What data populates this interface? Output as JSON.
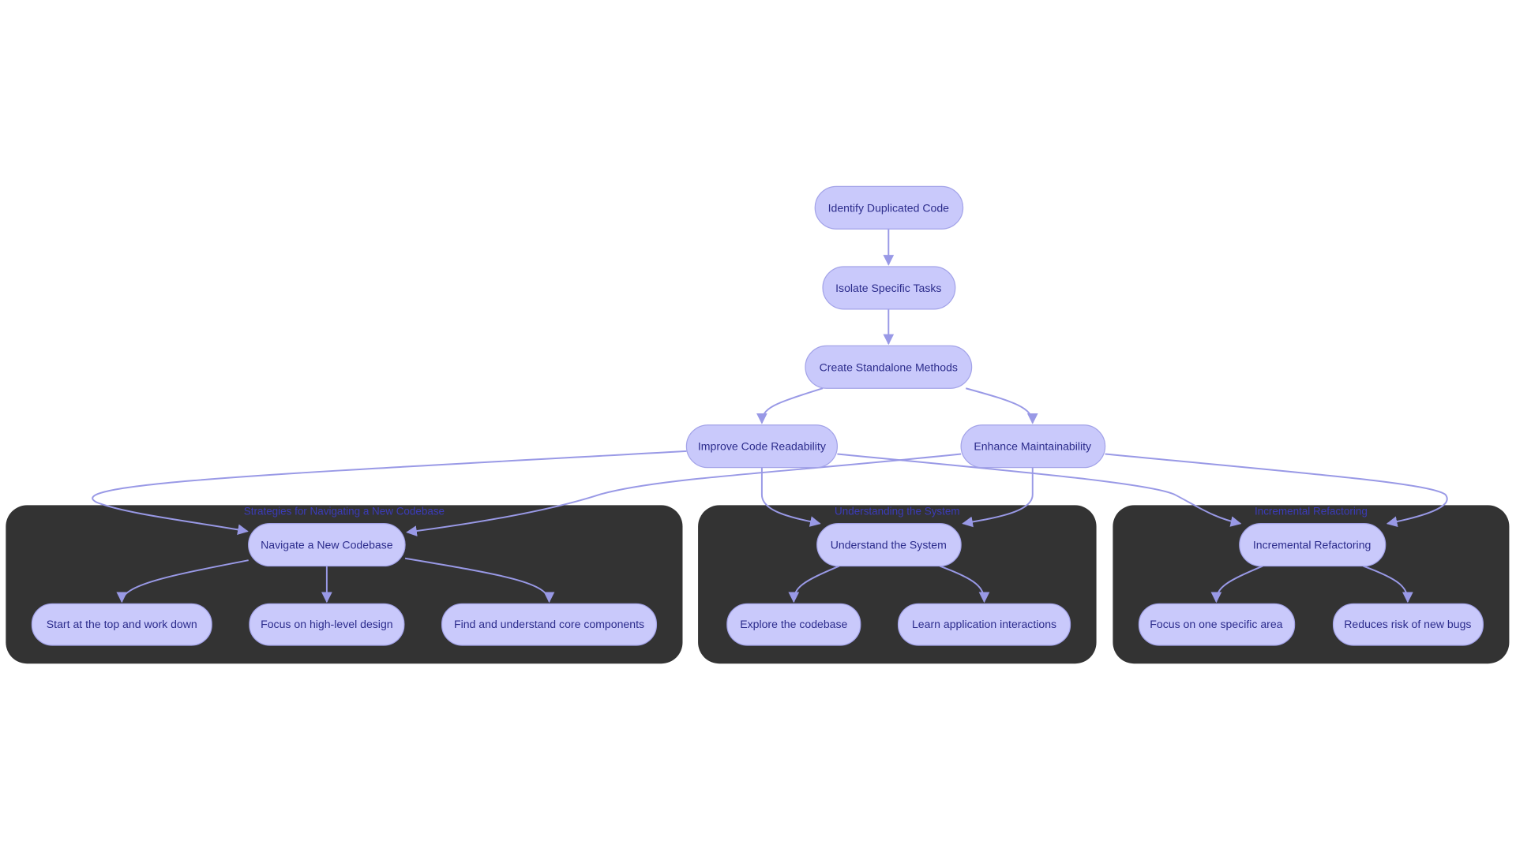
{
  "colors": {
    "node_fill": "#c9c9fb",
    "node_stroke": "#a3a3e8",
    "node_text": "#2c2c8c",
    "edge": "#9999e6",
    "cluster_fill": "#333333",
    "cluster_title": "#3b3bb8"
  },
  "clusters": [
    {
      "id": "c1",
      "title": "Strategies for Navigating a New Codebase"
    },
    {
      "id": "c2",
      "title": "Understanding the System"
    },
    {
      "id": "c3",
      "title": "Incremental Refactoring"
    }
  ],
  "nodes": {
    "identify": "Identify Duplicated Code",
    "isolate": "Isolate Specific Tasks",
    "create": "Create Standalone Methods",
    "improve": "Improve Code Readability",
    "enhance": "Enhance Maintainability",
    "navigate": "Navigate a New Codebase",
    "start": "Start at the top and work down",
    "focushigh": "Focus on high-level design",
    "find": "Find and understand core components",
    "understand": "Understand the System",
    "explore": "Explore the codebase",
    "learn": "Learn application interactions",
    "incremental": "Incremental Refactoring",
    "focusone": "Focus on one specific area",
    "reduces": "Reduces risk of new bugs"
  },
  "edges": [
    [
      "identify",
      "isolate"
    ],
    [
      "isolate",
      "create"
    ],
    [
      "create",
      "improve"
    ],
    [
      "create",
      "enhance"
    ],
    [
      "improve",
      "navigate"
    ],
    [
      "enhance",
      "navigate"
    ],
    [
      "improve",
      "understand"
    ],
    [
      "enhance",
      "understand"
    ],
    [
      "improve",
      "incremental"
    ],
    [
      "enhance",
      "incremental"
    ],
    [
      "navigate",
      "start"
    ],
    [
      "navigate",
      "focushigh"
    ],
    [
      "navigate",
      "find"
    ],
    [
      "understand",
      "explore"
    ],
    [
      "understand",
      "learn"
    ],
    [
      "incremental",
      "focusone"
    ],
    [
      "incremental",
      "reduces"
    ]
  ]
}
